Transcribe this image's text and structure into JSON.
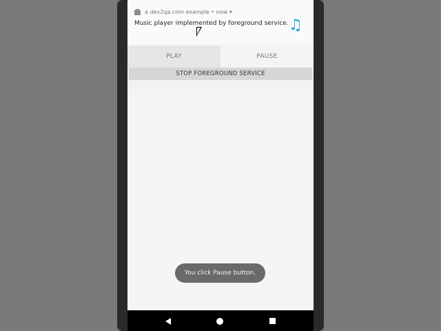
{
  "notification": {
    "app_meta": "a dev2qa.com example • now ▾",
    "text": "Music player implemented by foreground service.",
    "icon": "music-note-icon"
  },
  "actions": {
    "play_label": "PLAY",
    "pause_label": "PAUSE"
  },
  "app": {
    "stop_label": "STOP FOREGROUND SERVICE"
  },
  "toast": {
    "message": "You click Pause button."
  },
  "colors": {
    "music_icon": "#1a9fd6",
    "toast_bg": "#6a6a6a",
    "frame": "#2a2a2a"
  },
  "nav_bar": {
    "buttons": [
      "back-icon",
      "home-icon",
      "recents-icon"
    ]
  }
}
